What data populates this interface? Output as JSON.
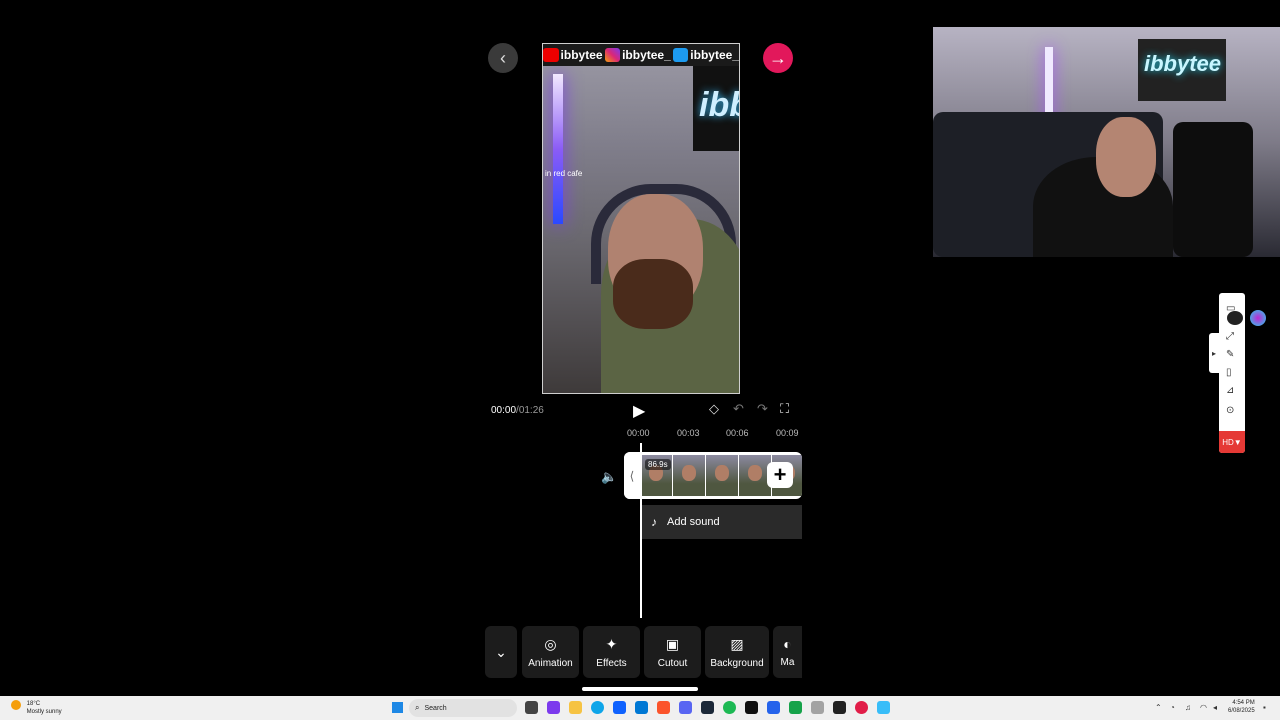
{
  "nav": {
    "back_icon": "chevron-left-icon",
    "next_icon": "arrow-right-icon"
  },
  "preview": {
    "handles": [
      "ibbytee",
      "ibbytee_",
      "ibbytee_"
    ],
    "sign_text": "ibb",
    "overlay_text": "in red cafe"
  },
  "webcam": {
    "sign_text": "ibbytee"
  },
  "player": {
    "current_time": "00:00",
    "separator": "/",
    "total_time": "01:26"
  },
  "ruler": {
    "ticks": [
      "00:00",
      "00:03",
      "00:06",
      "00:09"
    ]
  },
  "timeline": {
    "clip_duration": "86.9s",
    "add_sound_label": "Add sound"
  },
  "toolbar": {
    "items": [
      {
        "label": "Animation",
        "icon": "animation-icon"
      },
      {
        "label": "Effects",
        "icon": "sparkle-icon"
      },
      {
        "label": "Cutout",
        "icon": "cutout-icon"
      },
      {
        "label": "Background",
        "icon": "background-icon"
      },
      {
        "label": "Ma",
        "icon": "mask-icon"
      }
    ]
  },
  "side_panel": {
    "hd_label": "HD▼"
  },
  "taskbar": {
    "weather_temp": "18°C",
    "weather_desc": "Mostly sunny",
    "search_placeholder": "Search",
    "time": "4:54 PM",
    "date": "6/08/2025"
  },
  "colors": {
    "accent": "#e2185b",
    "hd": "#e53935"
  }
}
